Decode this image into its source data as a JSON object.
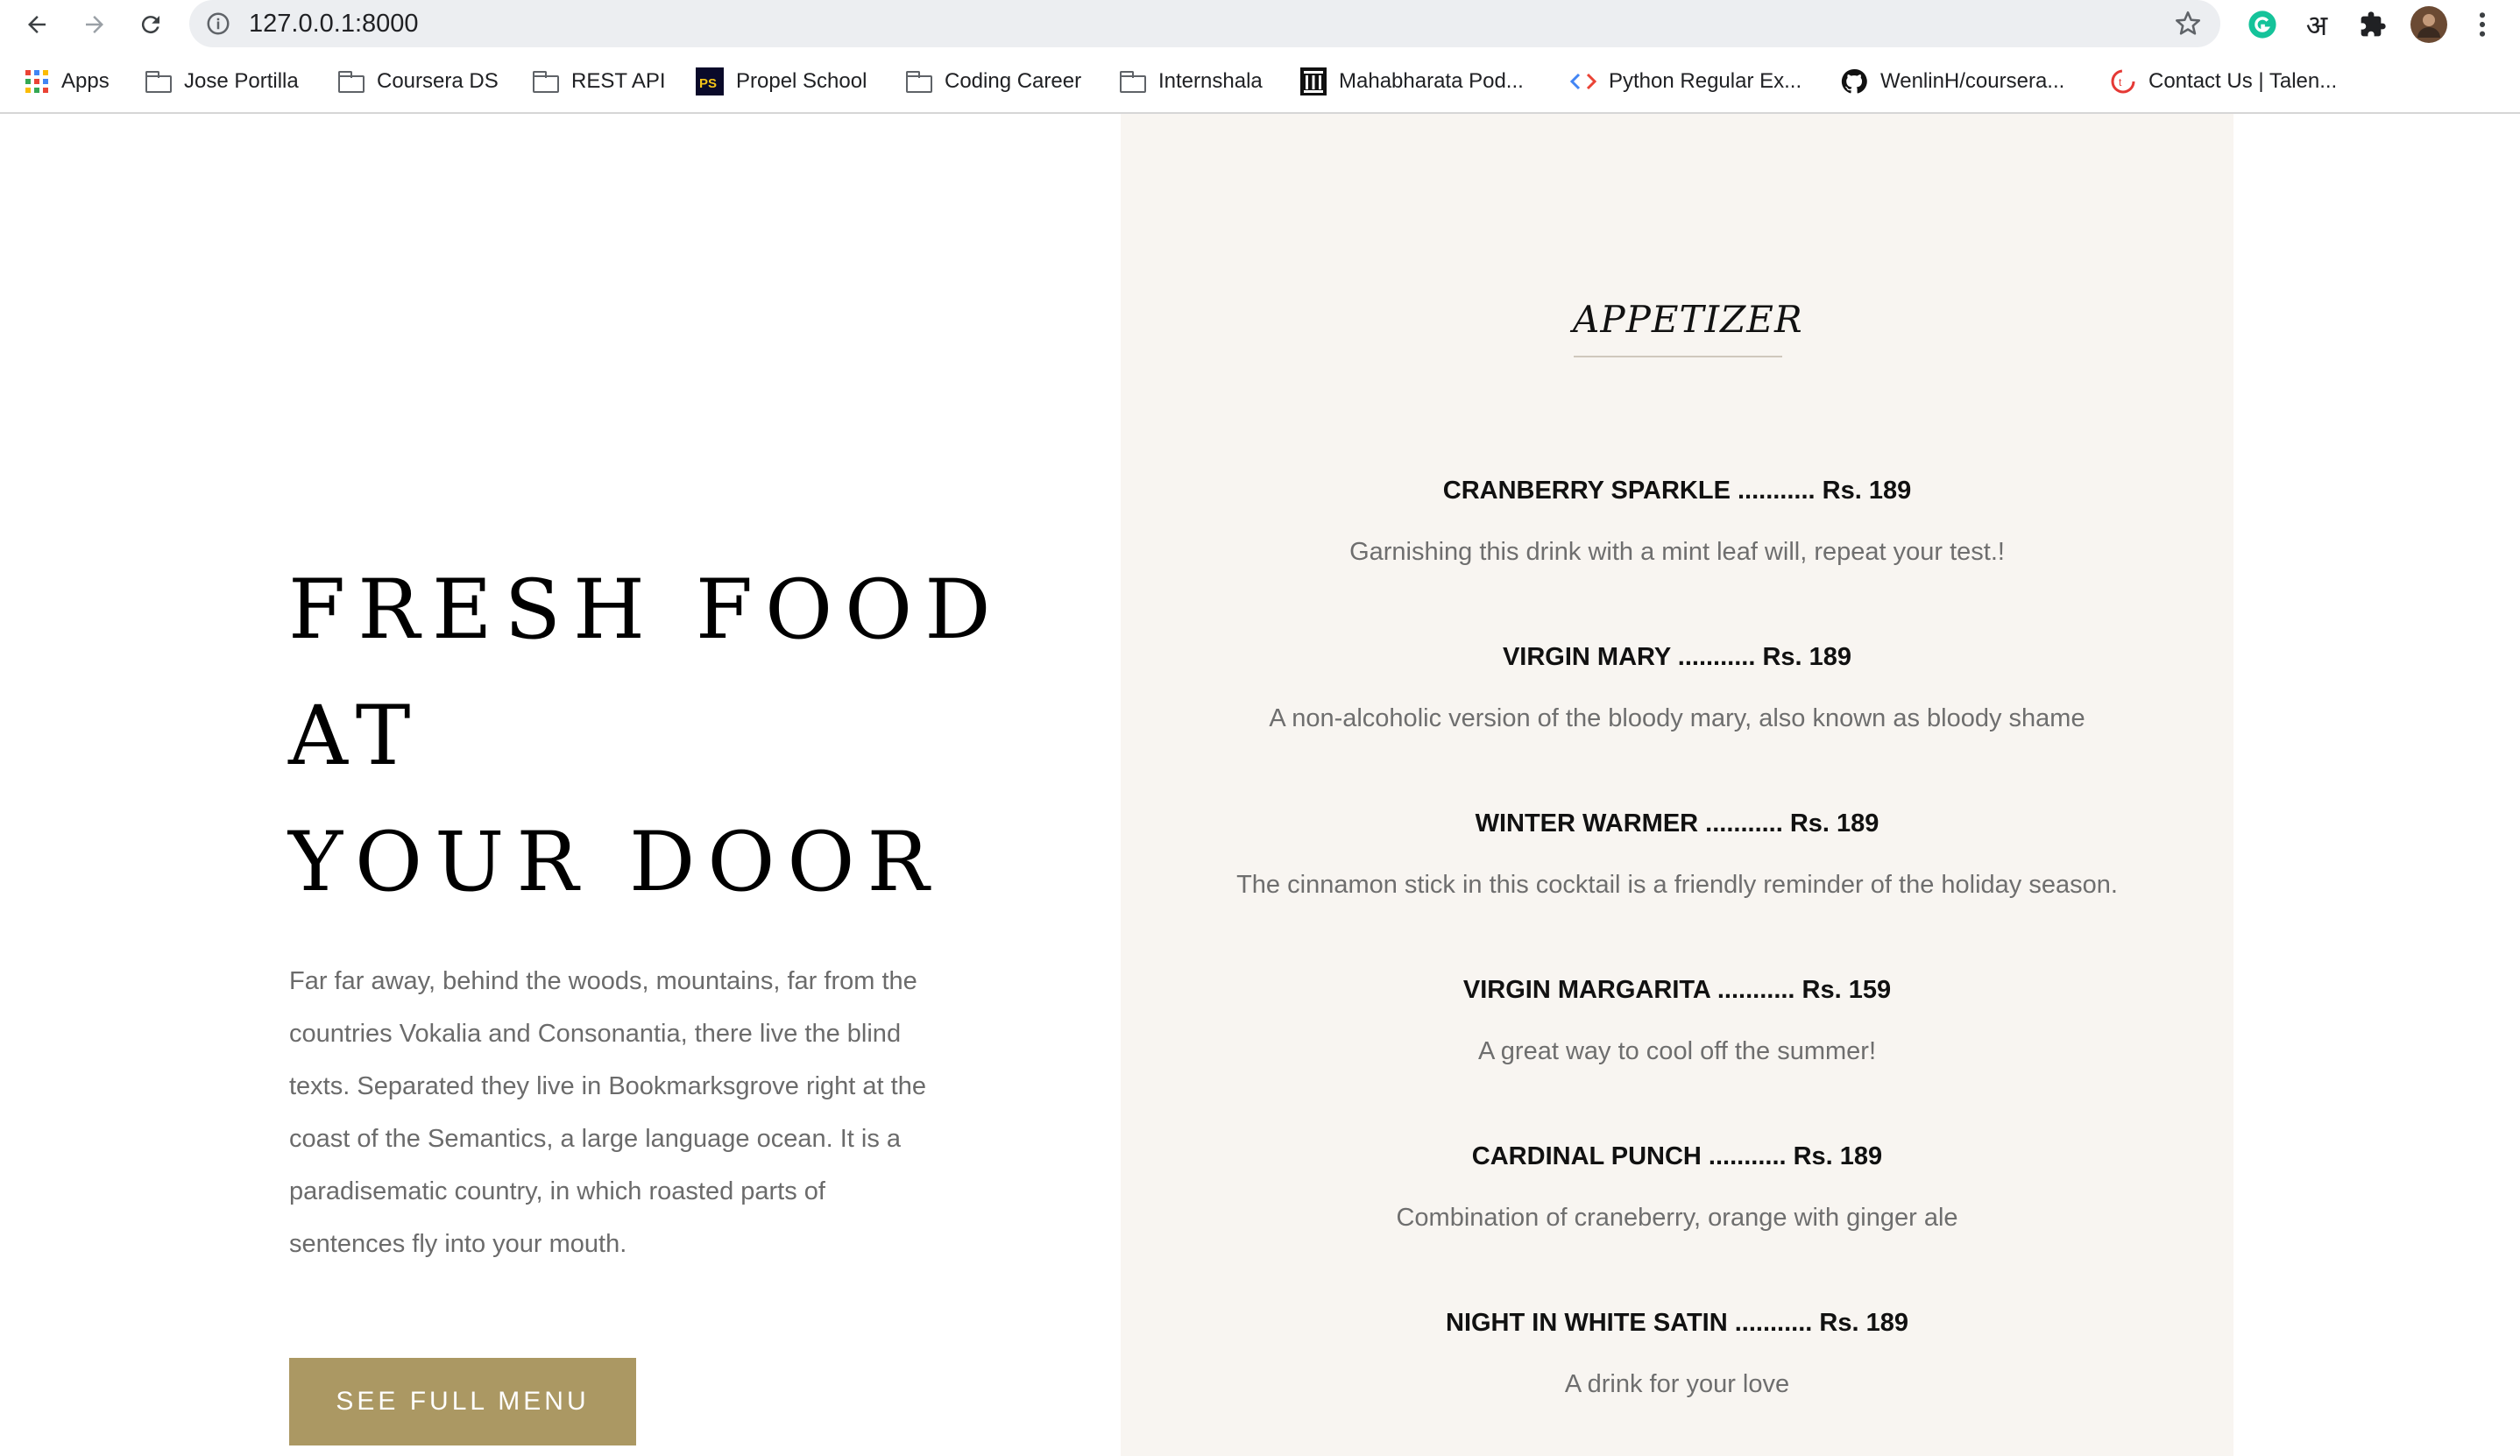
{
  "browser": {
    "url": "127.0.0.1:8000",
    "bookmarks": [
      {
        "label": "Apps",
        "icon": "apps-grid-icon"
      },
      {
        "label": "Jose Portilla",
        "icon": "folder-icon"
      },
      {
        "label": "Coursera DS",
        "icon": "folder-icon"
      },
      {
        "label": "REST API",
        "icon": "folder-icon"
      },
      {
        "label": "Propel School",
        "icon": "ps-logo-icon"
      },
      {
        "label": "Coding Career",
        "icon": "folder-icon"
      },
      {
        "label": "Internshala",
        "icon": "folder-icon"
      },
      {
        "label": "Mahabharata Pod...",
        "icon": "temple-icon"
      },
      {
        "label": "Python Regular Ex...",
        "icon": "code-icon"
      },
      {
        "label": "WenlinH/coursera...",
        "icon": "github-icon"
      },
      {
        "label": "Contact Us | Talen...",
        "icon": "talent-logo-icon"
      }
    ],
    "extension_hindi_glyph": "अ"
  },
  "hero": {
    "lines": [
      "FRESH FOOD",
      "AT",
      "YOUR DOOR"
    ],
    "paragraph_lines": [
      "Far far away, behind the woods, mountains, far from the",
      "countries Vokalia and Consonantia, there live the blind",
      "texts. Separated they live in Bookmarksgrove right at the",
      "coast of the Semantics, a large language ocean. It is a",
      "paradisematic country, in which roasted parts of",
      "sentences fly into your mouth."
    ],
    "button_label": "SEE FULL MENU"
  },
  "menu": {
    "section_title": "APPETIZER",
    "items": [
      {
        "name": "CRANBERRY SPARKLE ........... Rs. 189",
        "description": "Garnishing this drink with a mint leaf will, repeat your test.!"
      },
      {
        "name": "VIRGIN MARY ........... Rs. 189",
        "description": "A non-alcoholic version of the bloody mary, also known as bloody shame"
      },
      {
        "name": "WINTER WARMER ........... Rs. 189",
        "description": "The cinnamon stick in this cocktail is a friendly reminder of the holiday season."
      },
      {
        "name": "VIRGIN MARGARITA ........... Rs. 159",
        "description": "A great way to cool off the summer!"
      },
      {
        "name": "CARDINAL PUNCH ........... Rs. 189",
        "description": "Combination of craneberry, orange with ginger ale"
      },
      {
        "name": "NIGHT IN WHITE SATIN ........... Rs. 189",
        "description": "A drink for your love"
      }
    ]
  },
  "colors": {
    "accent": "#ab9863",
    "menu_panel": "#f8f5f1"
  }
}
